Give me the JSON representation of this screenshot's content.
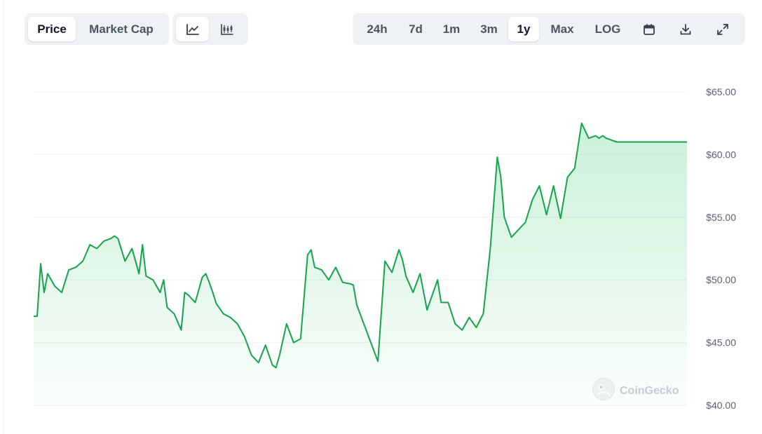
{
  "metric_tabs": [
    "Price",
    "Market Cap"
  ],
  "chart_type_icons": [
    "line-chart-icon",
    "candlestick-chart-icon"
  ],
  "range_tabs": [
    "24h",
    "7d",
    "1m",
    "3m",
    "1y",
    "Max",
    "LOG"
  ],
  "active_metric": "Price",
  "active_range": "1y",
  "tool_icons": [
    "calendar-icon",
    "download-icon",
    "fullscreen-icon"
  ],
  "watermark": "CoinGecko",
  "colors": {
    "line": "#16a34a",
    "fill": "#22c55e",
    "grid": "#eef0f3",
    "toolbar_bg": "#eff2f5"
  },
  "chart_data": {
    "type": "area",
    "title": "",
    "xlabel": "",
    "ylabel": "",
    "ylim": [
      40,
      65
    ],
    "yticks": [
      40,
      45,
      50,
      55,
      60,
      65
    ],
    "ytick_labels": [
      "$40.00",
      "$45.00",
      "$50.00",
      "$55.00",
      "$60.00",
      "$65.00"
    ],
    "x": [
      0,
      5,
      10,
      15,
      20,
      30,
      40,
      50,
      60,
      70,
      80,
      90,
      100,
      110,
      115,
      120,
      130,
      140,
      150,
      155,
      160,
      170,
      180,
      185,
      190,
      200,
      210,
      215,
      220,
      230,
      240,
      245,
      250,
      255,
      260,
      270,
      280,
      290,
      300,
      310,
      320,
      330,
      340,
      345,
      350,
      360,
      370,
      380,
      390,
      395,
      400,
      410,
      420,
      430,
      440,
      450,
      455,
      460,
      470,
      480,
      490,
      500,
      510,
      520,
      525,
      530,
      540,
      550,
      560,
      570,
      575,
      580,
      590,
      600,
      610,
      620,
      630,
      640,
      650,
      660,
      665,
      670,
      680,
      690,
      700,
      710,
      720,
      730,
      740,
      750,
      760,
      770,
      780,
      790,
      800,
      805,
      810,
      815,
      820,
      830,
      840,
      850,
      855,
      860,
      870,
      880,
      890,
      900,
      910,
      920,
      925,
      930
    ],
    "y": [
      47.1,
      47.1,
      51.3,
      49.0,
      50.5,
      49.5,
      49.0,
      50.8,
      51.0,
      51.5,
      52.8,
      52.5,
      53.1,
      53.3,
      53.5,
      53.3,
      51.5,
      52.5,
      50.5,
      52.8,
      50.3,
      50.0,
      49.0,
      50.0,
      47.8,
      47.3,
      46.0,
      49.0,
      48.8,
      48.2,
      50.2,
      50.5,
      49.8,
      49.0,
      48.1,
      47.3,
      47.0,
      46.5,
      45.5,
      44.0,
      43.4,
      44.8,
      43.2,
      43.0,
      44.0,
      46.5,
      45.0,
      45.3,
      52.0,
      52.4,
      51.0,
      50.8,
      50.0,
      51.0,
      49.8,
      49.7,
      49.6,
      48.0,
      46.5,
      45.0,
      43.5,
      51.5,
      50.6,
      52.4,
      51.6,
      50.3,
      49.0,
      50.5,
      47.6,
      49.2,
      50.0,
      48.2,
      48.2,
      46.5,
      46.0,
      47.0,
      46.2,
      47.3,
      52.5,
      59.8,
      58.2,
      55.0,
      53.4,
      54.0,
      54.6,
      56.4,
      57.5,
      55.2,
      57.5,
      54.9,
      58.2,
      58.9,
      62.5,
      61.3,
      61.5,
      61.3,
      61.5,
      61.3,
      61.2,
      61.0,
      61.0,
      61.0,
      61.0,
      61.0,
      61.0,
      61.0,
      61.0,
      61.0,
      61.0,
      61.0,
      61.0,
      61.0
    ]
  }
}
